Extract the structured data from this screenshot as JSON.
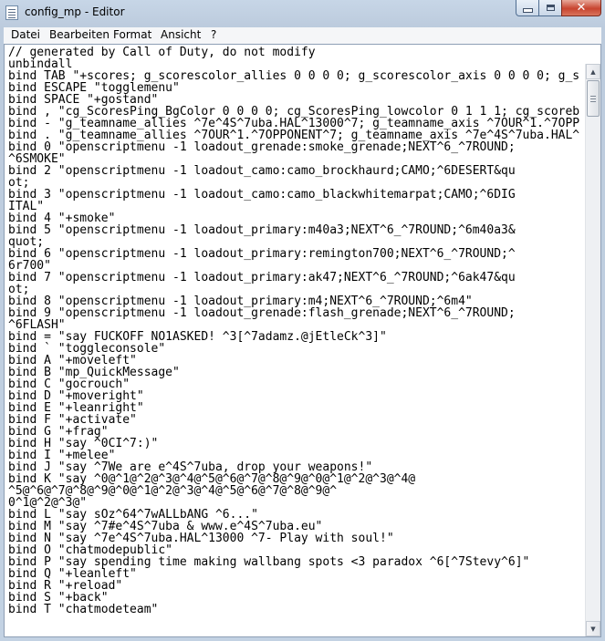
{
  "window": {
    "title": "config_mp - Editor",
    "icon": "notepad-icon",
    "controls": {
      "minimize": "minimize-icon",
      "maximize": "maximize-icon",
      "close": "close-icon"
    }
  },
  "menubar": {
    "items": [
      "Datei",
      "Bearbeiten",
      "Format",
      "Ansicht",
      "?"
    ]
  },
  "editor": {
    "lines": [
      "// generated by Call of Duty, do not modify",
      "unbindall",
      "bind TAB \"+scores; g_scorescolor_allies 0 0 0 0; g_scorescolor_axis 0 0 0 0; g_s",
      "bind ESCAPE \"togglemenu\"",
      "bind SPACE \"+gostand\"",
      "bind , \"cg_ScoresPing_BgColor 0 0 0 0; cg_ScoresPing_lowcolor 0 1 1 1; cg_scoreb",
      "bind - \"g_teamname_allies ^7e^4S^7uba.HAL^13000^7; g_teamname_axis ^7OUR^1.^7OPP",
      "bind . \"g_teamname_allies ^7OUR^1.^7OPPONENT^7; g_teamname_axis ^7e^4S^7uba.HAL^",
      "bind 0 \"openscriptmenu -1 loadout_grenade:smoke_grenade;NEXT^6_^7ROUND;",
      "^6SMOKE\"",
      "bind 2 \"openscriptmenu -1 loadout_camo:camo_brockhaurd;CAMO;^6DESERT&qu",
      "ot;",
      "bind 3 \"openscriptmenu -1 loadout_camo:camo_blackwhitemarpat;CAMO;^6DIG",
      "ITAL\"",
      "bind 4 \"+smoke\"",
      "bind 5 \"openscriptmenu -1 loadout_primary:m40a3;NEXT^6_^7ROUND;^6m40a3&",
      "quot;",
      "bind 6 \"openscriptmenu -1 loadout_primary:remington700;NEXT^6_^7ROUND;^",
      "6r700\"",
      "bind 7 \"openscriptmenu -1 loadout_primary:ak47;NEXT^6_^7ROUND;^6ak47&qu",
      "ot;",
      "bind 8 \"openscriptmenu -1 loadout_primary:m4;NEXT^6_^7ROUND;^6m4\"",
      "bind 9 \"openscriptmenu -1 loadout_grenade:flash_grenade;NEXT^6_^7ROUND;",
      "^6FLASH\"",
      "bind = \"say FUCKOFF NO1ASKED! ^3[^7adamz.@jEtleCk^3]\"",
      "bind ` \"toggleconsole\"",
      "bind A \"+moveleft\"",
      "bind B \"mp_QuickMessage\"",
      "bind C \"gocrouch\"",
      "bind D \"+moveright\"",
      "bind E \"+leanright\"",
      "bind F \"+activate\"",
      "bind G \"+frag\"",
      "bind H \"say ^0CI^7:)\"",
      "bind I \"+melee\"",
      "bind J \"say ^7We are e^4S^7uba, drop your weapons!\"",
      "bind K \"say ^0@^1@^2@^3@^4@^5@^6@^7@^8@^9@^0@^1@^2@^3@^4@",
      "^5@^6@^7@^8@^9@^0@^1@^2@^3@^4@^5@^6@^7@^8@^9@^",
      "0^1@^2@^3@\"",
      "bind L \"say sOz^64^7wALLbANG ^6...\"",
      "bind M \"say ^7#e^4S^7uba & www.e^4S^7uba.eu\"",
      "bind N \"say ^7e^4S^7uba.HAL^13000 ^7- Play with soul!\"",
      "bind O \"chatmodepublic\"",
      "bind P \"say spending time making wallbang spots <3 paradox ^6[^7Stevy^6]\"",
      "bind Q \"+leanleft\"",
      "bind R \"+reload\"",
      "bind S \"+back\"",
      "bind T \"chatmodeteam\""
    ]
  },
  "scrollbar": {
    "up": "scroll-up-arrow-icon",
    "down": "scroll-down-arrow-icon"
  }
}
